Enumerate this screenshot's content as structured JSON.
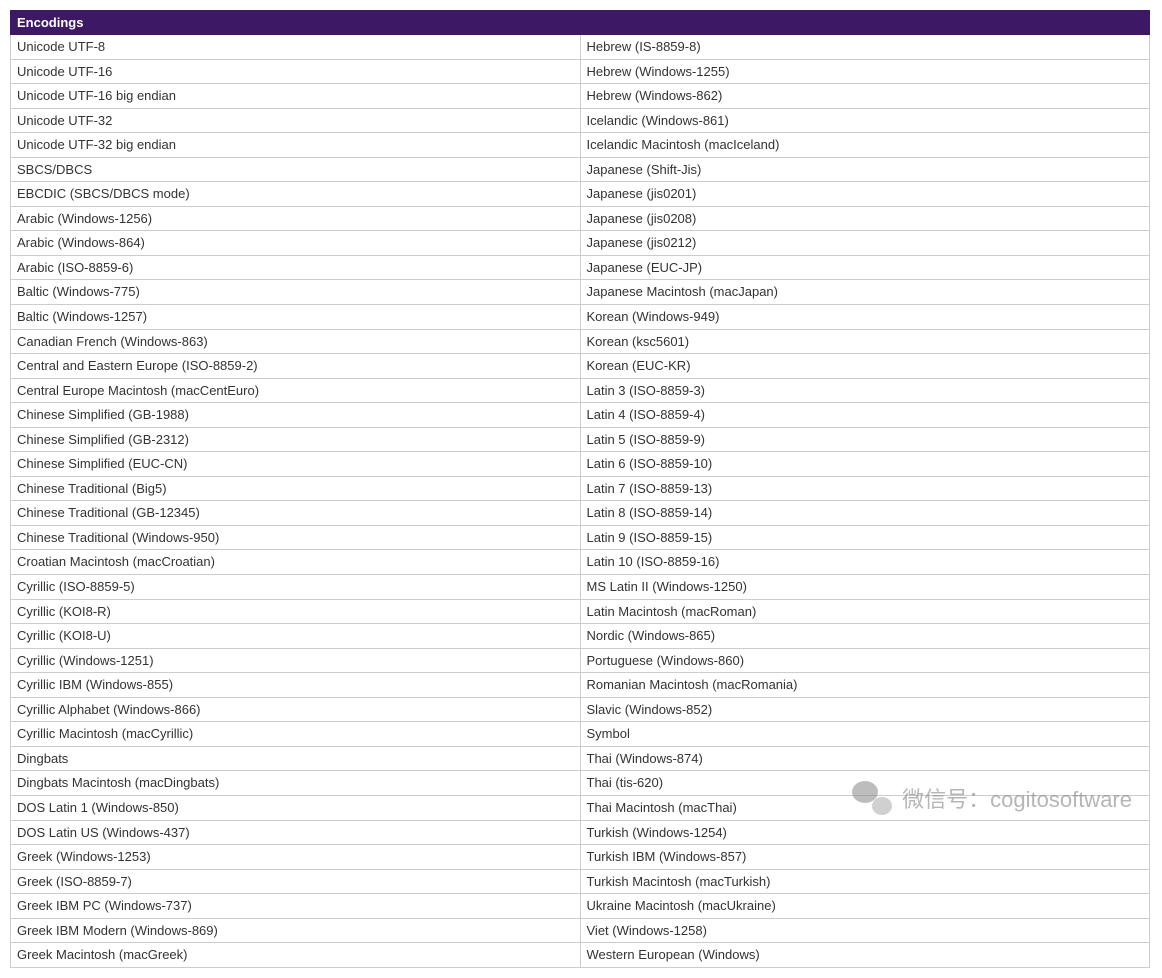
{
  "header": "Encodings",
  "rows": [
    {
      "left": "Unicode UTF-8",
      "right": "Hebrew (IS-8859-8)"
    },
    {
      "left": "Unicode UTF-16",
      "right": "Hebrew (Windows-1255)"
    },
    {
      "left": "Unicode UTF-16 big endian",
      "right": "Hebrew (Windows-862)"
    },
    {
      "left": "Unicode UTF-32",
      "right": "Icelandic (Windows-861)"
    },
    {
      "left": "Unicode UTF-32 big endian",
      "right": "Icelandic Macintosh (macIceland)"
    },
    {
      "left": "SBCS/DBCS",
      "right": "Japanese (Shift-Jis)"
    },
    {
      "left": "EBCDIC (SBCS/DBCS mode)",
      "right": "Japanese (jis0201)"
    },
    {
      "left": "Arabic (Windows-1256)",
      "right": "Japanese (jis0208)"
    },
    {
      "left": "Arabic (Windows-864)",
      "right": "Japanese (jis0212)"
    },
    {
      "left": "Arabic (ISO-8859-6)",
      "right": "Japanese (EUC-JP)"
    },
    {
      "left": "Baltic (Windows-775)",
      "right": "Japanese Macintosh (macJapan)"
    },
    {
      "left": "Baltic (Windows-1257)",
      "right": "Korean (Windows-949)"
    },
    {
      "left": "Canadian French (Windows-863)",
      "right": "Korean (ksc5601)"
    },
    {
      "left": "Central and Eastern Europe (ISO-8859-2)",
      "right": "Korean (EUC-KR)"
    },
    {
      "left": "Central Europe Macintosh (macCentEuro)",
      "right": "Latin 3 (ISO-8859-3)"
    },
    {
      "left": "Chinese Simplified (GB-1988)",
      "right": "Latin 4 (ISO-8859-4)"
    },
    {
      "left": "Chinese Simplified (GB-2312)",
      "right": "Latin 5 (ISO-8859-9)"
    },
    {
      "left": "Chinese Simplified (EUC-CN)",
      "right": "Latin 6 (ISO-8859-10)"
    },
    {
      "left": "Chinese Traditional (Big5)",
      "right": "Latin 7 (ISO-8859-13)"
    },
    {
      "left": "Chinese Traditional (GB-12345)",
      "right": "Latin 8 (ISO-8859-14)"
    },
    {
      "left": "Chinese Traditional (Windows-950)",
      "right": "Latin 9 (ISO-8859-15)"
    },
    {
      "left": "Croatian Macintosh (macCroatian)",
      "right": "Latin 10 (ISO-8859-16)"
    },
    {
      "left": "Cyrillic (ISO-8859-5)",
      "right": "MS Latin II (Windows-1250)"
    },
    {
      "left": "Cyrillic (KOI8-R)",
      "right": "Latin Macintosh (macRoman)"
    },
    {
      "left": "Cyrillic (KOI8-U)",
      "right": "Nordic (Windows-865)"
    },
    {
      "left": "Cyrillic (Windows-1251)",
      "right": "Portuguese (Windows-860)"
    },
    {
      "left": "Cyrillic IBM (Windows-855)",
      "right": "Romanian Macintosh (macRomania)"
    },
    {
      "left": "Cyrillic Alphabet (Windows-866)",
      "right": "Slavic (Windows-852)"
    },
    {
      "left": "Cyrillic Macintosh (macCyrillic)",
      "right": "Symbol"
    },
    {
      "left": "Dingbats",
      "right": "Thai (Windows-874)"
    },
    {
      "left": "Dingbats Macintosh (macDingbats)",
      "right": "Thai (tis-620)"
    },
    {
      "left": "DOS Latin 1 (Windows-850)",
      "right": "Thai Macintosh (macThai)"
    },
    {
      "left": "DOS Latin US (Windows-437)",
      "right": "Turkish (Windows-1254)"
    },
    {
      "left": "Greek (Windows-1253)",
      "right": "Turkish IBM (Windows-857)"
    },
    {
      "left": "Greek (ISO-8859-7)",
      "right": "Turkish Macintosh (macTurkish)"
    },
    {
      "left": "Greek IBM PC (Windows-737)",
      "right": "Ukraine Macintosh (macUkraine)"
    },
    {
      "left": "Greek IBM Modern (Windows-869)",
      "right": "Viet (Windows-1258)"
    },
    {
      "left": "Greek Macintosh (macGreek)",
      "right": "Western European (Windows)"
    }
  ],
  "watermark": {
    "text": "微信号：cogitosoftware"
  }
}
